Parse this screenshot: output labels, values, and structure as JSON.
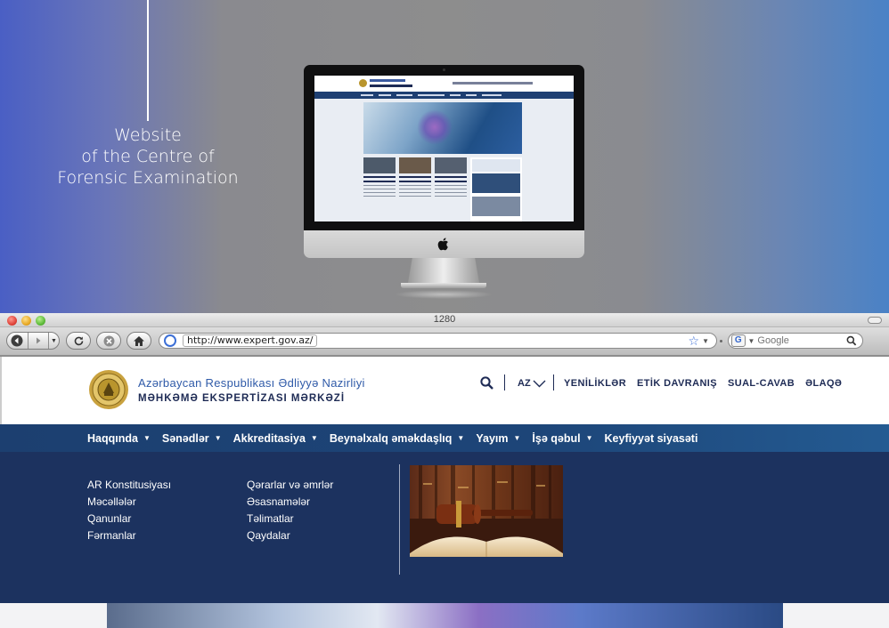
{
  "hero": {
    "caption": [
      "Website",
      "of the Centre of",
      "Forensic Examination"
    ]
  },
  "browser": {
    "window_title": "1280",
    "url": "http://www.expert.gov.az/",
    "search_placeholder": "Google",
    "search_engine_icon": "G"
  },
  "site": {
    "brand_line1": "Azərbaycan Respublikası Ədliyyə Nazirliyi",
    "brand_line2": "MƏHKƏMƏ EKSPERTİZASI MƏRKƏZİ",
    "language": "AZ",
    "top_links": [
      "YENİLİKLƏR",
      "ETİK DAVRANIŞ",
      "SUAL-CAVAB",
      "ƏLAQƏ"
    ],
    "nav": [
      {
        "label": "Haqqında",
        "caret": "▼",
        "active": false
      },
      {
        "label": "Sənədlər",
        "caret": "▼",
        "active": true
      },
      {
        "label": "Akkreditasiya",
        "caret": "▼",
        "active": false
      },
      {
        "label": "Beynəlxalq əməkdaşlıq",
        "caret": "▼",
        "active": false
      },
      {
        "label": "Yayım",
        "caret": "▼",
        "active": false
      },
      {
        "label": "İşə qəbul",
        "caret": "▼",
        "active": false
      },
      {
        "label": "Keyfiyyət siyasəti",
        "caret": "",
        "active": false
      }
    ],
    "mega_col1": [
      "AR Konstitusiyası",
      "Məcəllələr",
      "Qanunlar",
      "Fərmanlar"
    ],
    "mega_col2": [
      "Qərarlar və əmrlər",
      "Əsasnamələr",
      "Təlimatlar",
      "Qaydalar"
    ]
  },
  "colors": {
    "nav_bg": "#1c3f70",
    "mega_bg": "#1c325f",
    "brand_blue": "#2f5aa8",
    "brand_dark": "#1e2b55"
  }
}
